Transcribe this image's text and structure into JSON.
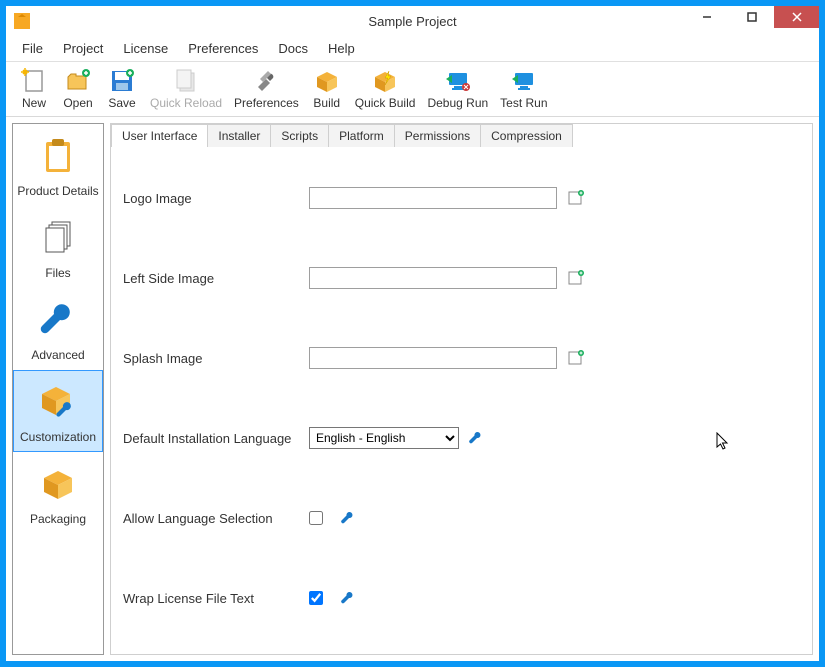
{
  "window": {
    "title": "Sample Project",
    "controls": {
      "min": "—",
      "max": "☐",
      "close": "✕"
    }
  },
  "menu": [
    "File",
    "Project",
    "License",
    "Preferences",
    "Docs",
    "Help"
  ],
  "toolbar": [
    {
      "id": "new",
      "label": "New"
    },
    {
      "id": "open",
      "label": "Open"
    },
    {
      "id": "save",
      "label": "Save"
    },
    {
      "id": "quick-reload",
      "label": "Quick Reload",
      "disabled": true
    },
    {
      "id": "preferences",
      "label": "Preferences"
    },
    {
      "id": "build",
      "label": "Build"
    },
    {
      "id": "quick-build",
      "label": "Quick Build"
    },
    {
      "id": "debug-run",
      "label": "Debug Run"
    },
    {
      "id": "test-run",
      "label": "Test Run"
    }
  ],
  "sidebar": {
    "items": [
      {
        "id": "product-details",
        "label": "Product Details"
      },
      {
        "id": "files",
        "label": "Files"
      },
      {
        "id": "advanced",
        "label": "Advanced"
      },
      {
        "id": "customization",
        "label": "Customization",
        "active": true
      },
      {
        "id": "packaging",
        "label": "Packaging"
      }
    ]
  },
  "tabs": [
    {
      "id": "user-interface",
      "label": "User Interface",
      "active": true
    },
    {
      "id": "installer",
      "label": "Installer"
    },
    {
      "id": "scripts",
      "label": "Scripts"
    },
    {
      "id": "platform",
      "label": "Platform"
    },
    {
      "id": "permissions",
      "label": "Permissions"
    },
    {
      "id": "compression",
      "label": "Compression"
    }
  ],
  "form": {
    "logo_label": "Logo Image",
    "logo_value": "",
    "left_label": "Left Side Image",
    "left_value": "",
    "splash_label": "Splash Image",
    "splash_value": "",
    "lang_label": "Default Installation Language",
    "lang_value": "English - English",
    "allow_lang_label": "Allow Language Selection",
    "allow_lang_checked": false,
    "wrap_label": "Wrap License File Text",
    "wrap_checked": true
  }
}
